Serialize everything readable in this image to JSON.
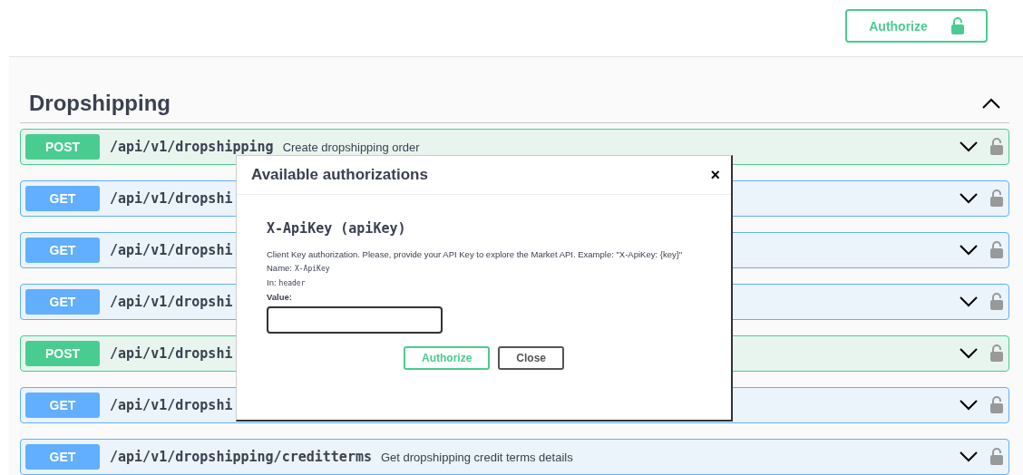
{
  "top_bar": {
    "authorize_button": "Authorize"
  },
  "section": {
    "title": "Dropshipping",
    "expanded": true
  },
  "operations": [
    {
      "method": "POST",
      "path": "/api/v1/dropshipping",
      "summary": "Create dropshipping order"
    },
    {
      "method": "GET",
      "path": "/api/v1/dropshi"
    },
    {
      "method": "GET",
      "path": "/api/v1/dropshi"
    },
    {
      "method": "GET",
      "path": "/api/v1/dropshi"
    },
    {
      "method": "POST",
      "path": "/api/v1/dropshi"
    },
    {
      "method": "GET",
      "path": "/api/v1/dropshi"
    },
    {
      "method": "GET",
      "path": "/api/v1/dropshipping/creditterms",
      "summary": "Get dropshipping credit terms details"
    }
  ],
  "modal": {
    "title": "Available authorizations",
    "close": "×",
    "scheme_title": "X-ApiKey (apiKey)",
    "description": "Client Key authorization. Please, provide your API Key to explore the Market API. Example: \"X-ApiKey: {key}\"",
    "name_label": "Name:",
    "name_value": "X-ApiKey",
    "in_label": "In:",
    "in_value": "header",
    "value_label": "Value:",
    "buttons": [
      "Authorize",
      "Close"
    ]
  }
}
